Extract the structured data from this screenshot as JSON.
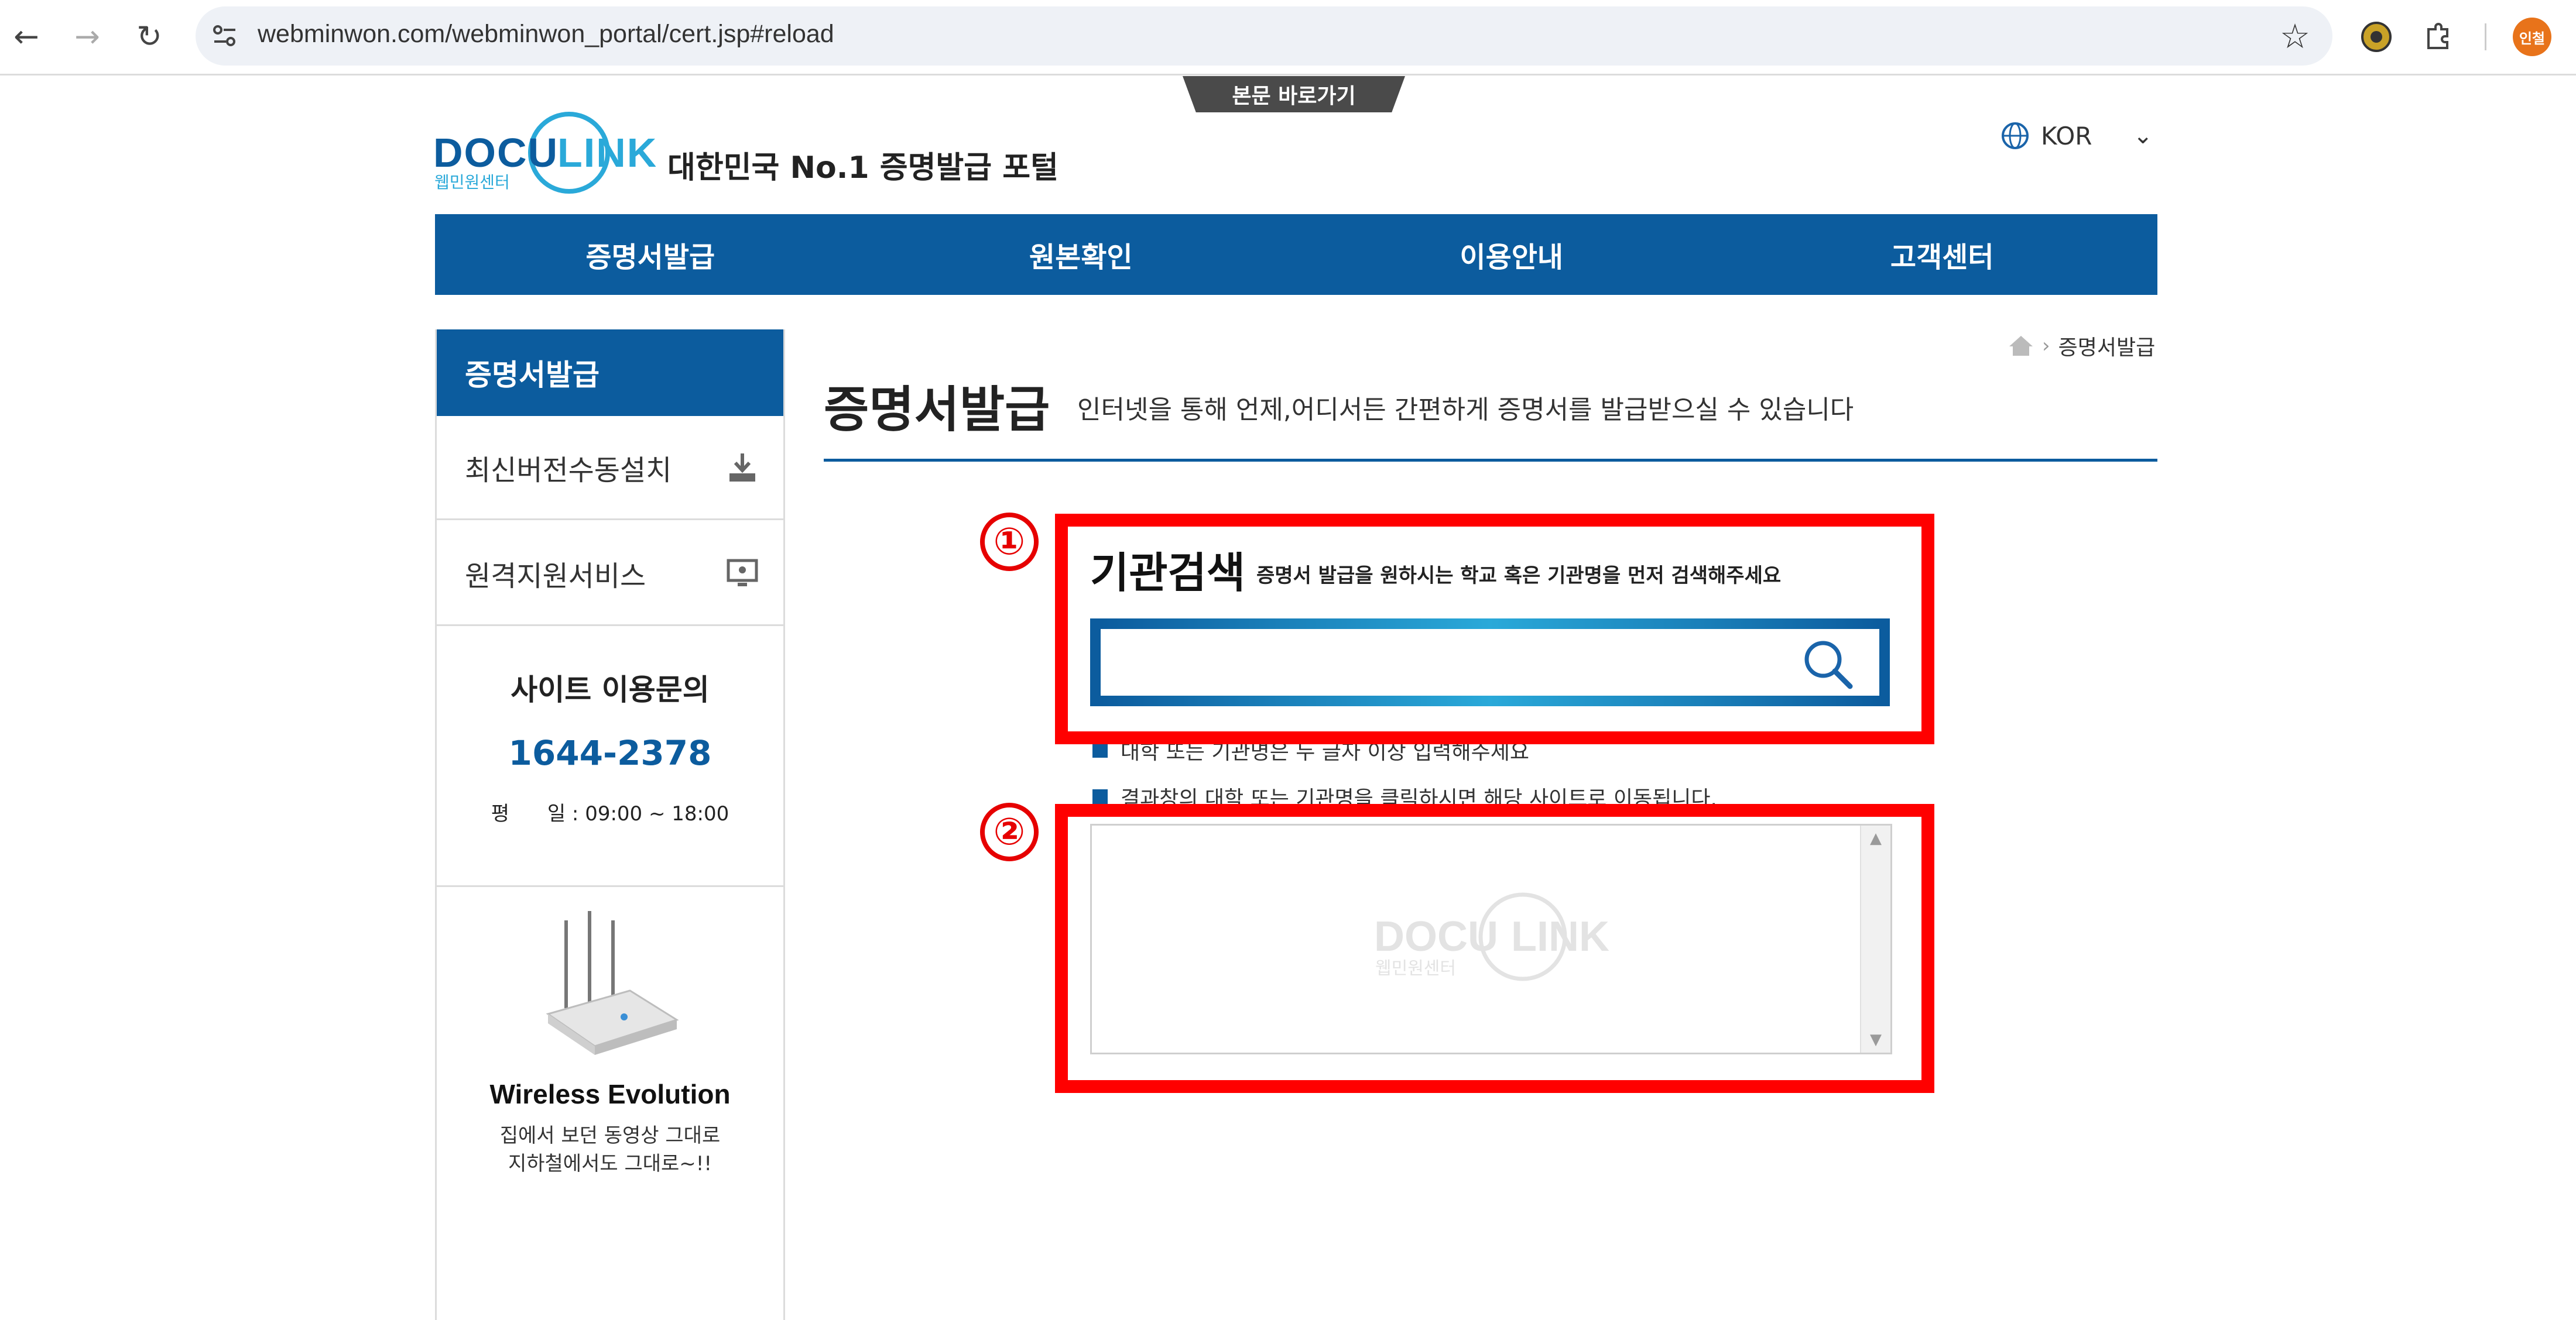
{
  "browser": {
    "url": "webminwon.com/webminwon_portal/cert.jsp#reload",
    "profile_label": "인철"
  },
  "skip_link": "본문 바로가기",
  "header": {
    "logo_brand": "DOCU LINK",
    "logo_sub": "웹민원센터",
    "slogan": "대한민국 No.1 증명발급 포털",
    "language": "KOR"
  },
  "main_nav": [
    "증명서발급",
    "원본확인",
    "이용안내",
    "고객센터"
  ],
  "sidebar": {
    "title": "증명서발급",
    "items": [
      {
        "label": "최신버전수동설치",
        "icon": "download-icon"
      },
      {
        "label": "원격지원서비스",
        "icon": "remote-support-icon"
      }
    ],
    "contact": {
      "title": "사이트 이용문의",
      "phone": "1644-2378",
      "hours": "평      일 : 09:00 ~ 18:00"
    },
    "ad": {
      "title": "Wireless Evolution",
      "line1": "집에서 보던 동영상 그대로",
      "line2": "지하철에서도 그대로~!!"
    }
  },
  "breadcrumb": {
    "current": "증명서발급"
  },
  "page": {
    "title": "증명서발급",
    "description": "인터넷을 통해 언제,어디서든 간편하게 증명서를 발급받으실 수 있습니다"
  },
  "search": {
    "marker": "①",
    "title": "기관검색",
    "subtitle": "증명서 발급을 원하시는 학교 혹은 기관명을 먼저 검색해주세요",
    "value": "",
    "placeholder": ""
  },
  "notes": [
    "대학 또는 기관명은 두 글자 이상 입력해주세요",
    "결과창의 대학 또는 기관명을 클릭하시면 해당 사이트로 이동됩니다."
  ],
  "results": {
    "marker": "②",
    "watermark_brand": "DOCU LINK",
    "watermark_sub": "웹민원센터"
  },
  "colors": {
    "brand_blue": "#0c5c9e",
    "highlight_red": "#ff0000"
  }
}
